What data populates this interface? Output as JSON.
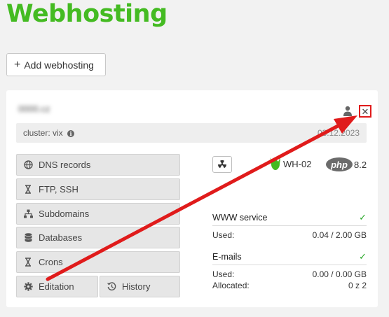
{
  "page": {
    "title": "Webhosting"
  },
  "toolbar": {
    "add_label": "Add webhosting"
  },
  "card": {
    "domain": "0000.cz",
    "cluster_label": "cluster: vix",
    "date": "03.12.2023",
    "server_name": "WH-02",
    "php_label": "php",
    "php_version": "8.2",
    "buttons": {
      "dns": "DNS records",
      "ftp": "FTP, SSH",
      "subdomains": "Subdomains",
      "databases": "Databases",
      "crons": "Crons",
      "edit": "Editation",
      "history": "History"
    },
    "www": {
      "title": "WWW service",
      "used_label": "Used:",
      "used_value": "0.04 /  2.00 GB"
    },
    "emails": {
      "title": "E-mails",
      "used_label": "Used:",
      "used_value": "0.00 /  0.00 GB",
      "allocated_label": "Allocated:",
      "allocated_value": "0 z 2"
    }
  },
  "colors": {
    "brand": "#44bb22",
    "annotation": "#e01b1b",
    "ok": "#2aa82a"
  },
  "icons": [
    "plus-icon",
    "user-icon",
    "close-icon",
    "info-icon",
    "globe-icon",
    "hourglass-icon",
    "sitemap-icon",
    "database-icon",
    "gear-icon",
    "history-icon",
    "radiation-icon",
    "server-logo-icon",
    "php-logo",
    "check-icon"
  ]
}
